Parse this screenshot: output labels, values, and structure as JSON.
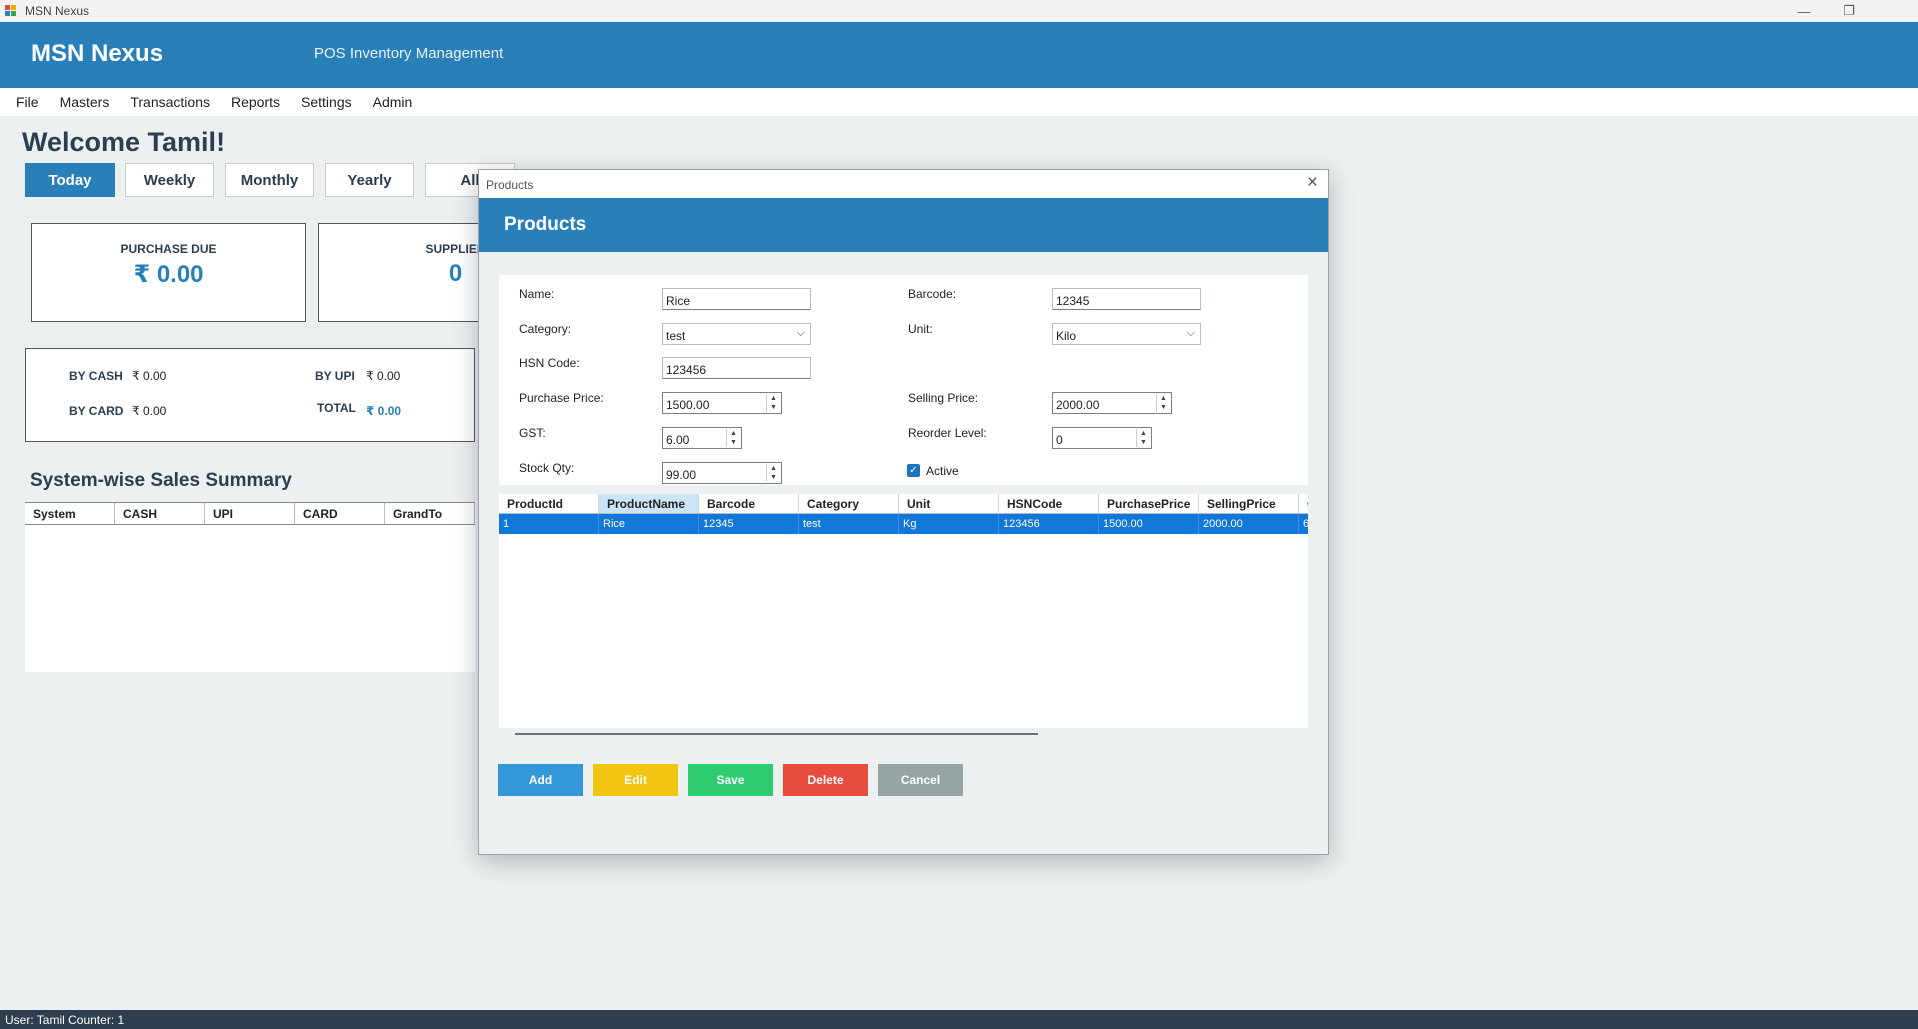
{
  "window": {
    "title": "MSN Nexus"
  },
  "header": {
    "brand": "MSN Nexus",
    "subtitle": "POS  Inventory Management"
  },
  "menu": [
    "File",
    "Masters",
    "Transactions",
    "Reports",
    "Settings",
    "Admin"
  ],
  "welcome": "Welcome Tamil!",
  "periods": {
    "today": "Today",
    "weekly": "Weekly",
    "monthly": "Monthly",
    "yearly": "Yearly",
    "all": "All"
  },
  "cards": {
    "purchase_due": {
      "label": "PURCHASE DUE",
      "value": "₹ 0.00"
    },
    "supplier": {
      "label": "SUPPLIER",
      "value": "0"
    }
  },
  "payments": {
    "by_cash": {
      "label": "BY CASH",
      "value": "₹ 0.00"
    },
    "by_card": {
      "label": "BY CARD",
      "value": "₹ 0.00"
    },
    "by_upi": {
      "label": "BY UPI",
      "value": "₹ 0.00"
    },
    "total": {
      "label": "TOTAL",
      "value": "₹ 0.00"
    }
  },
  "summary": {
    "title": "System-wise Sales Summary",
    "columns": [
      "System",
      "CASH",
      "UPI",
      "CARD",
      "GrandTo"
    ]
  },
  "dialog": {
    "window_title": "Products",
    "heading": "Products",
    "form": {
      "name": {
        "label": "Name:",
        "value": "Rice"
      },
      "barcode": {
        "label": "Barcode:",
        "value": "12345"
      },
      "category": {
        "label": "Category:",
        "value": "test"
      },
      "unit": {
        "label": "Unit:",
        "value": "Kilo"
      },
      "hsn_code": {
        "label": "HSN Code:",
        "value": "123456"
      },
      "purchase_price": {
        "label": "Purchase Price:",
        "value": "1500.00"
      },
      "selling_price": {
        "label": "Selling Price:",
        "value": "2000.00"
      },
      "gst": {
        "label": "GST:",
        "value": "6.00"
      },
      "reorder_level": {
        "label": "Reorder Level:",
        "value": "0"
      },
      "stock_qty": {
        "label": "Stock Qty:",
        "value": "99.00"
      },
      "active": {
        "label": "Active",
        "checked": true
      }
    },
    "grid": {
      "columns": [
        "ProductId",
        "ProductName",
        "Barcode",
        "Category",
        "Unit",
        "HSNCode",
        "PurchasePrice",
        "SellingPrice",
        "G"
      ],
      "rows": [
        [
          "1",
          "Rice",
          "12345",
          "test",
          "Kg",
          "123456",
          "1500.00",
          "2000.00",
          "6"
        ]
      ]
    },
    "buttons": {
      "add": "Add",
      "edit": "Edit",
      "save": "Save",
      "delete": "Delete",
      "cancel": "Cancel"
    }
  },
  "status": "User: Tamil  Counter: 1",
  "colors": {
    "primary": "#2980b9",
    "add": "#3498db",
    "edit": "#f1c40f",
    "save": "#2ecc71",
    "delete": "#e74c3c",
    "cancel": "#95a5a6",
    "selected_row": "#1177d8"
  }
}
